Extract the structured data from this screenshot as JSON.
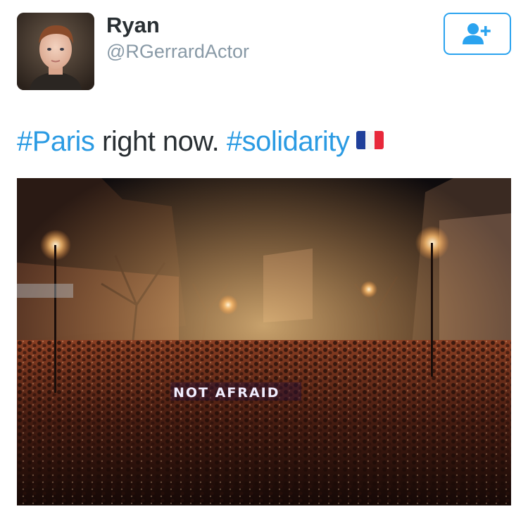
{
  "author": {
    "display_name": "Ryan",
    "username": "@RGerrardActor",
    "avatar_icon": "avatar-photo"
  },
  "follow_button": {
    "icon": "add-user-icon",
    "color": "#2aa3ef"
  },
  "tweet": {
    "parts": [
      {
        "text": "#Paris",
        "type": "hashtag"
      },
      {
        "text": " right now. ",
        "type": "text"
      },
      {
        "text": "#solidarity",
        "type": "hashtag"
      }
    ],
    "emoji": "flag-france-icon",
    "hashtag_color": "#2b9be3"
  },
  "media": {
    "description_icon": "photo-crowd-at-night",
    "sign_text": "NOT AFRAID"
  }
}
